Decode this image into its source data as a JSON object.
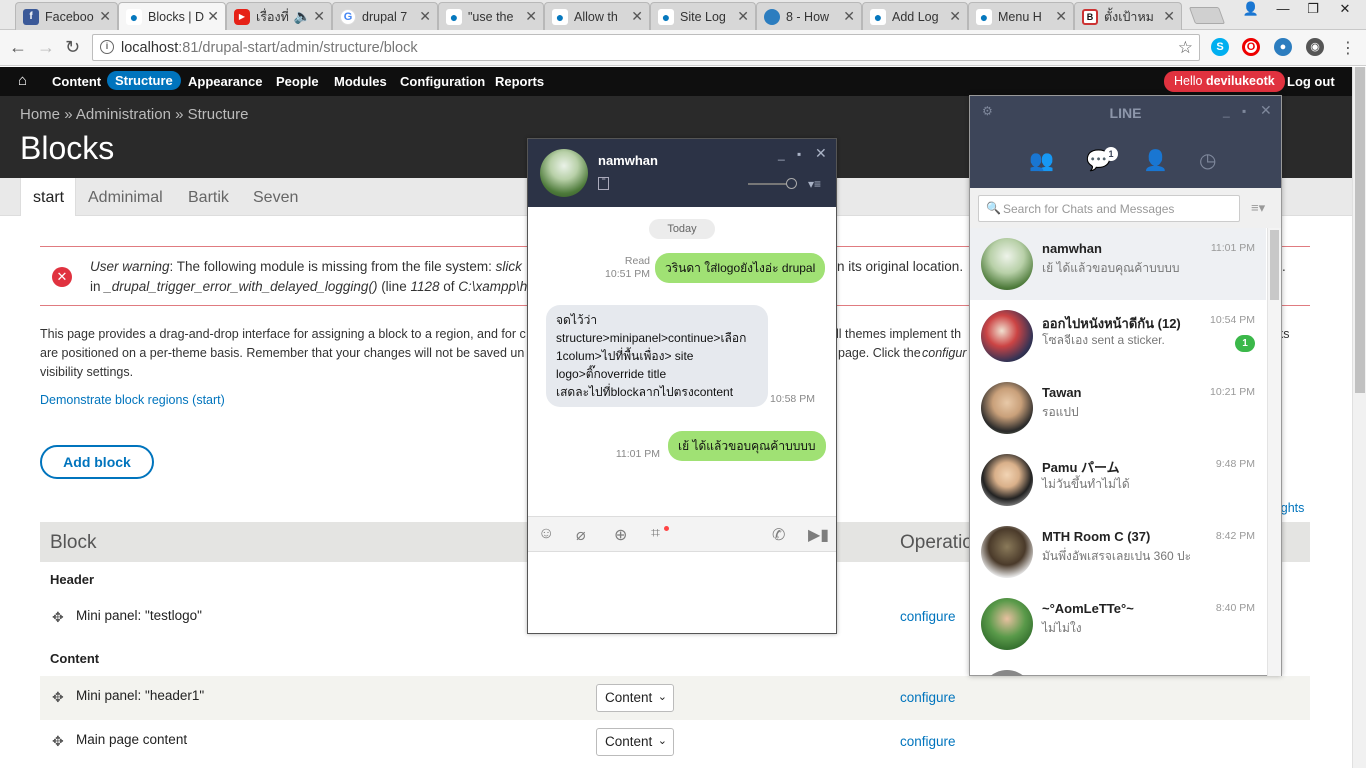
{
  "browser": {
    "tabs": [
      {
        "title": "Faceboo",
        "favicon": "facebook-icon"
      },
      {
        "title": "Blocks | D",
        "favicon": "drupal-icon"
      },
      {
        "title": "เรื่องที่",
        "favicon": "youtube-icon"
      },
      {
        "title": "drupal 7",
        "favicon": "google-icon"
      },
      {
        "title": "\"use the",
        "favicon": "drupal-icon"
      },
      {
        "title": "Allow th",
        "favicon": "drupal-icon"
      },
      {
        "title": "Site Log",
        "favicon": "drupal-icon"
      },
      {
        "title": "8 - How",
        "favicon": "drupal-icon"
      },
      {
        "title": "Add Log",
        "favicon": "drupal-icon"
      },
      {
        "title": "Menu H",
        "favicon": "drupal-icon"
      },
      {
        "title": "ตั้งเป้าหม",
        "favicon": "site-icon"
      }
    ],
    "active_tab": 1,
    "url_host": "localhost",
    "url_rest": ":81/drupal-start/admin/structure/block"
  },
  "toolbar": {
    "items": [
      "Content",
      "Structure",
      "Appearance",
      "People",
      "Modules",
      "Configuration",
      "Reports"
    ],
    "active": "Structure",
    "hello_prefix": "Hello ",
    "user": "devilukeotk",
    "logout": "Log out"
  },
  "header": {
    "breadcrumb": [
      "Home",
      "Administration",
      "Structure"
    ],
    "title": "Blocks"
  },
  "theme_tabs": [
    "start",
    "Adminimal",
    "Bartik",
    "Seven"
  ],
  "warning": {
    "label": "User warning",
    "line1_a": ": The following module is missing from the file system: ",
    "line1_b": "slick",
    "line1_c": "in its original location.",
    "line2_a": "in ",
    "line2_b": "_drupal_trigger_error_with_delayed_logging()",
    "line2_c": " (line ",
    "line2_d": "1128",
    "line2_e": " of ",
    "line2_f": "C:\\xampp\\h",
    "trailing": "."
  },
  "intro": {
    "line1_a": "This page provides a drag-and-drop interface for assigning a block to a region, and for c",
    "line1_b": "ll themes implement th",
    "line1_c": "ks",
    "line2_a": "are positioned on a per-theme basis. Remember that your changes will not be saved un",
    "line2_b": "page. Click the ",
    "line2_c": "configur",
    "line3": "visibility settings."
  },
  "demo_link": "Demonstrate block regions (start)",
  "add_block": "Add block",
  "weights_link": "ights",
  "table": {
    "col_block": "Block",
    "col_ops": "Operatio",
    "regions": [
      {
        "name": "Header",
        "rows": [
          {
            "block": "Mini panel: \"testlogo\"",
            "region": "",
            "op": "configure"
          }
        ]
      },
      {
        "name": "Content",
        "rows": [
          {
            "block": "Mini panel: \"header1\"",
            "region": "Content",
            "op": "configure"
          },
          {
            "block": "Main page content",
            "region": "Content",
            "op": "configure"
          }
        ]
      }
    ]
  },
  "chat": {
    "name": "namwhan",
    "day": "Today",
    "messages": [
      {
        "from": "me",
        "text": "วรินดา ใส่logoยังไงอ่ะ drupal",
        "status": "Read",
        "time": "10:51 PM"
      },
      {
        "from": "them",
        "lines": [
          "จดไว้ว่า",
          "structure>minipanel>continue>เลือก",
          "1colum>ไปที่พื้นเพื่อง> site",
          "logo>ติ๊กoverride title",
          "เสดละไปที่blockลากไปตรงcontent"
        ],
        "time": "10:58 PM"
      },
      {
        "from": "me",
        "text": "เย้ ได้แล้วขอบคุณค้าบบบบ",
        "time": "11:01 PM"
      }
    ]
  },
  "line": {
    "title": "LINE",
    "unread_chats": "1",
    "search_placeholder": "Search for Chats and Messages",
    "chats": [
      {
        "name": "namwhan",
        "message": "เย้ ได้แล้วขอบคุณค้าบบบบ",
        "time": "11:01 PM",
        "badge": ""
      },
      {
        "name": "ออกไปหนังหน้าดีกัน (12)",
        "message": "โซลจีเอง sent a sticker.",
        "time": "10:54 PM",
        "badge": "1"
      },
      {
        "name": "Tawan",
        "message": "รอแปป",
        "time": "10:21 PM",
        "badge": ""
      },
      {
        "name": "Pamu パーム",
        "message": "ไม่วันขึ้นทำไม่ได้",
        "time": "9:48 PM",
        "badge": ""
      },
      {
        "name": "MTH Room C (37)",
        "message": "มันพึ่งอัพเสรจเลยเปน 360 ปะ",
        "time": "8:42 PM",
        "badge": ""
      },
      {
        "name": "~°AomLeTTe°~",
        "message": "ไม่ไม่ใง",
        "time": "8:40 PM",
        "badge": ""
      }
    ]
  }
}
